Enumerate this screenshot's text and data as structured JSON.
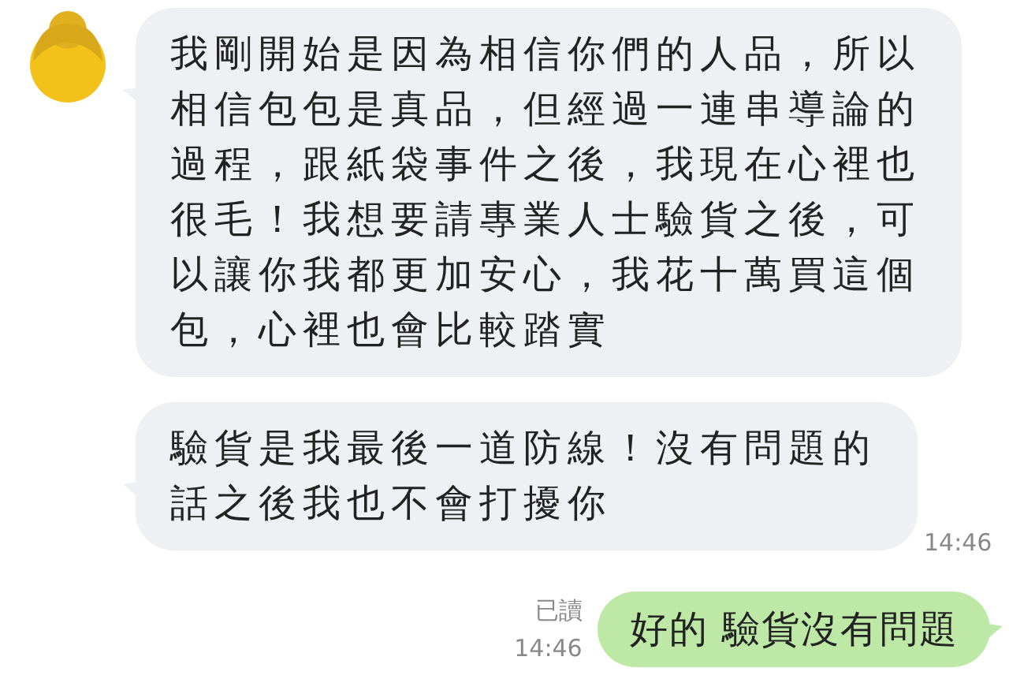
{
  "messages": [
    {
      "kind": "received",
      "text": "我剛開始是因為相信你們的人品，所以相信包包是真品，但經過一連串導論的過程，跟紙袋事件之後，我現在心裡也很毛！我想要請專業人士驗貨之後，可以讓你我都更加安心，我花十萬買這個包，心裡也會比較踏實",
      "avatar": true
    },
    {
      "kind": "received",
      "text": "驗貨是我最後一道防線！沒有問題的話之後我也不會打擾你",
      "avatar": false,
      "time": "14:46"
    },
    {
      "kind": "sent",
      "text": "好的 驗貨沒有問題",
      "read": "已讀",
      "time": "14:46"
    }
  ]
}
